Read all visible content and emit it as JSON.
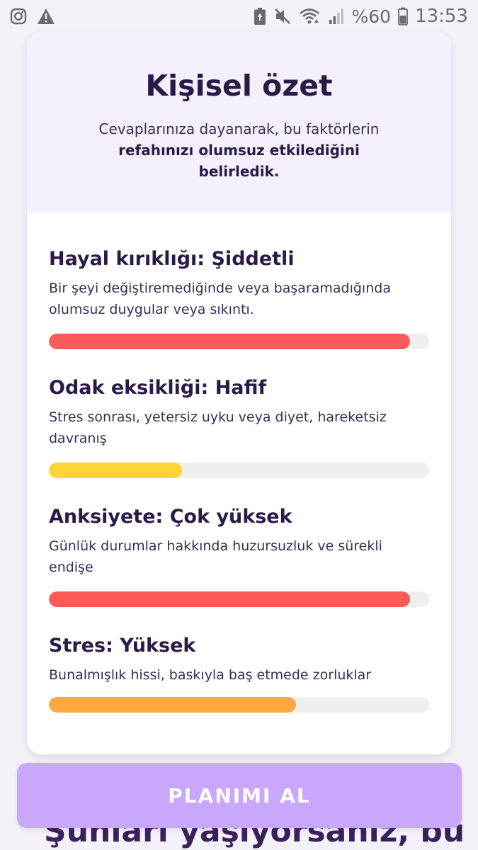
{
  "status_bar": {
    "battery_percent": "%60",
    "clock": "13:53",
    "icons": [
      "instagram-icon",
      "warning-icon",
      "battery-saver-icon",
      "mute-icon",
      "wifi-icon",
      "signal-icon",
      "battery-icon"
    ]
  },
  "summary": {
    "title": "Kişisel özet",
    "subtitle_regular": "Cevaplarınıza dayanarak, bu faktörlerin",
    "subtitle_bold": "refahınızı olumsuz etkilediğini belirledik."
  },
  "factors": [
    {
      "title": "Hayal kırıklığı: Şiddetli",
      "description": "Bir şeyi değiştiremediğinde veya başaramadığında olumsuz duygular veya sıkıntı.",
      "level": 0.95,
      "color": "#fd5a5a"
    },
    {
      "title": "Odak eksikliği: Hafif",
      "description": "Stres sonrası, yetersiz uyku veya diyet, hareketsiz davranış",
      "level": 0.35,
      "color": "#fdd534"
    },
    {
      "title": "Anksiyete: Çok yüksek",
      "description": "Günlük durumlar hakkında huzursuzluk ve sürekli endişe",
      "level": 0.95,
      "color": "#fd5a5a"
    },
    {
      "title": "Stres: Yüksek",
      "description": "Bunalmışlık hissi, baskıyla baş etmede zorluklar",
      "level": 0.65,
      "color": "#ffa83f"
    }
  ],
  "cta": {
    "label": "PLANIMI AL",
    "color": "#c9a8fb"
  },
  "below_fold_heading": "Şunları yaşıyorsanız, bu"
}
